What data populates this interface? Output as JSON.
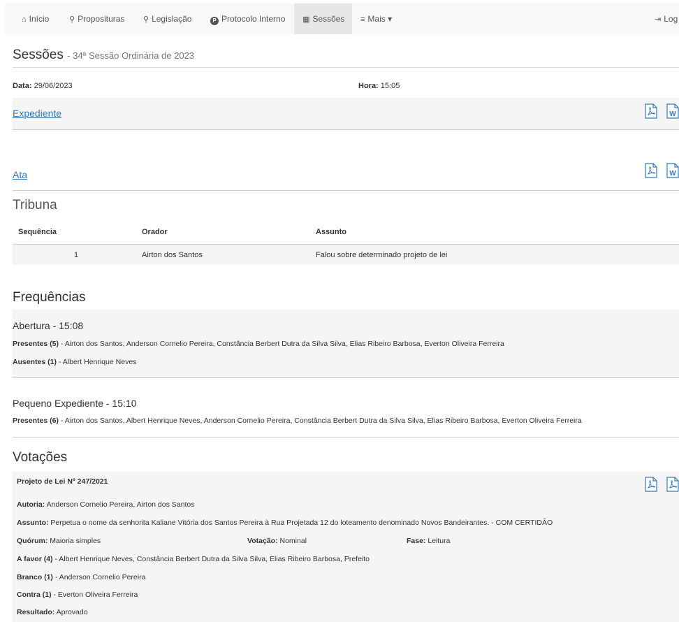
{
  "nav": {
    "items": [
      {
        "icon": "home-icon",
        "glyph": "⌂",
        "label": "Início"
      },
      {
        "icon": "search-icon",
        "glyph": "⚲",
        "label": "Proposituras"
      },
      {
        "icon": "search-icon",
        "glyph": "⚲",
        "label": "Legislação"
      },
      {
        "icon": "protocol-icon",
        "glyph": "P",
        "label": "Protocolo Interno"
      },
      {
        "icon": "calendar-icon",
        "glyph": "▦",
        "label": "Sessões"
      },
      {
        "icon": "menu-icon",
        "glyph": "≡",
        "label": "Mais ▾"
      }
    ],
    "login": {
      "glyph": "⇥",
      "label": "Log"
    }
  },
  "header": {
    "title": "Sessões",
    "subtitle": "- 34ª Sessão Ordinária de 2023"
  },
  "session": {
    "date_label": "Data:",
    "date": "29/06/2023",
    "time_label": "Hora:",
    "time": "15:05"
  },
  "docs": [
    {
      "label": "Expediente"
    },
    {
      "label": "Ata"
    }
  ],
  "tribuna": {
    "title": "Tribuna",
    "headers": [
      "Sequência",
      "Orador",
      "Assunto"
    ],
    "rows": [
      {
        "seq": "1",
        "orador": "Airton dos Santos",
        "assunto": "Falou sobre determinado projeto de lei"
      }
    ]
  },
  "frequencias": {
    "title": "Frequências",
    "blocks": [
      {
        "heading": "Abertura - 15:08",
        "presentes_label": "Presentes (5)",
        "presentes": " - Airton dos Santos, Anderson Cornelio Pereira, Constância Berbert Dutra da Silva Silva, Elias Ribeiro Barbosa, Everton Oliveira Ferreira",
        "ausentes_label": "Ausentes (1)",
        "ausentes": " - Albert Henrique Neves"
      },
      {
        "heading": "Pequeno Expediente - 15:10",
        "presentes_label": "Presentes (6)",
        "presentes": " - Airton dos Santos, Albert Henrique Neves, Anderson Cornelio Pereira, Constância Berbert Dutra da Silva Silva, Elias Ribeiro Barbosa, Everton Oliveira Ferreira"
      }
    ]
  },
  "votacoes": {
    "title": "Votações",
    "item": {
      "title": "Projeto de Lei Nº 247/2021",
      "autoria_label": "Autoria:",
      "autoria": " Anderson Cornelio Pereira, Airton dos Santos",
      "assunto_label": "Assunto:",
      "assunto": " Perpetua o nome da senhorita Kaliane Vitória dos Santos Pereira à Rua Projetada 12 do loteamento denominado Novos Bandeirantes. - COM CERTIDÃO",
      "quorum_label": "Quórum:",
      "quorum": " Maioria simples",
      "votacao_label": "Votação:",
      "votacao": " Nominal",
      "fase_label": "Fase:",
      "fase": " Leitura",
      "afavor_label": "A favor (4)",
      "afavor": " - Albert Henrique Neves, Constância Berbert Dutra da Silva Silva, Elias Ribeiro Barbosa, Prefeito",
      "branco_label": "Branco (1)",
      "branco": " - Anderson Cornelio Pereira",
      "contra_label": "Contra (1)",
      "contra": " - Everton Oliveira Ferreira",
      "resultado_label": "Resultado:",
      "resultado": " Aprovado"
    }
  },
  "icons": {
    "pdf": "pdf-icon",
    "word": "word-icon",
    "word_letter": "W"
  }
}
